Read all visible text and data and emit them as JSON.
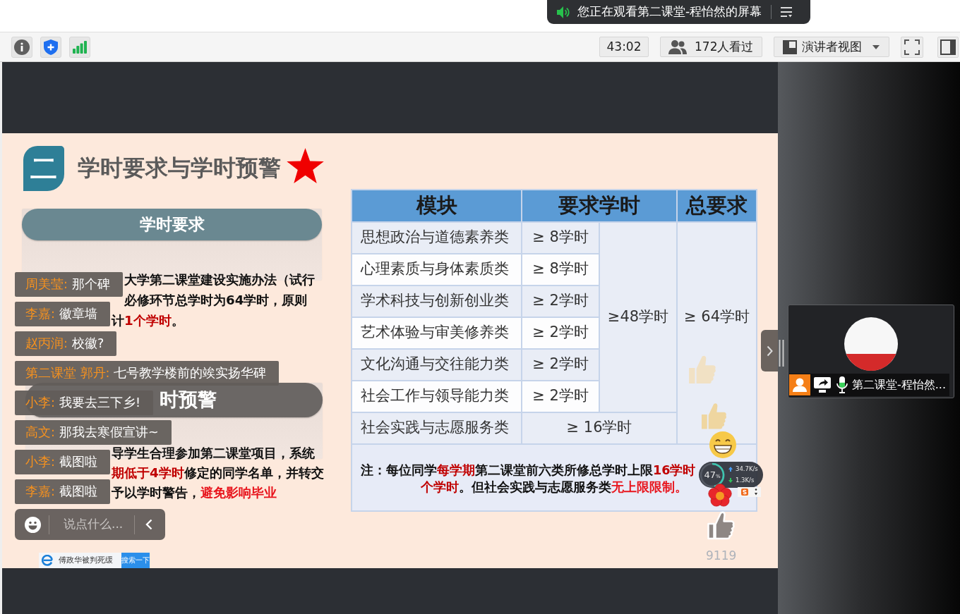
{
  "share_banner": {
    "text": "您正在观看第二课堂-程怡然的屏幕"
  },
  "toolbar": {
    "timer": "43:02",
    "viewers": "172人看过",
    "view_mode": "演讲者视图"
  },
  "slide": {
    "section_number": "二",
    "title": "学时要求与学时预警",
    "sections": [
      {
        "heading": "学时要求",
        "lines": [
          [
            {
              "text": "大学第二课堂建设实施办法（试行",
              "color": "#111111"
            }
          ],
          [
            {
              "text": "必修环节总学时为64学时，原则",
              "color": "#111111"
            }
          ],
          [
            {
              "text": "计",
              "color": "#111111"
            },
            {
              "text": "1个学时",
              "color": "#c00000"
            },
            {
              "text": "。",
              "color": "#111111"
            }
          ]
        ]
      },
      {
        "heading": "时预警",
        "lines": [
          [
            {
              "text": "导学生合理参加第二课堂项目，系统",
              "color": "#111111"
            }
          ],
          [
            {
              "text": "期低于4学时",
              "color": "#c00000"
            },
            {
              "text": "修定的同学名单，并转交",
              "color": "#111111"
            }
          ],
          [
            {
              "text": "予以学时警告，",
              "color": "#111111"
            },
            {
              "text": "避免影响毕业",
              "color": "#e8141c"
            }
          ]
        ]
      }
    ],
    "table": {
      "columns": [
        "模块",
        "要求学时",
        "总要求"
      ],
      "rows": [
        {
          "module": "思想政治与道德素养类",
          "hours": "≥ 8学时",
          "kind": "core"
        },
        {
          "module": "心理素质与身体素质类",
          "hours": "≥ 8学时",
          "kind": "core"
        },
        {
          "module": "学术科技与创新创业类",
          "hours": "≥ 2学时",
          "kind": "core"
        },
        {
          "module": "艺术体验与审美修养类",
          "hours": "≥ 2学时",
          "kind": "core"
        },
        {
          "module": "文化沟通与交往能力类",
          "hours": "≥ 2学时",
          "kind": "core"
        },
        {
          "module": "社会工作与领导能力类",
          "hours": "≥ 2学时",
          "kind": "core"
        },
        {
          "module": "社会实践与志愿服务类",
          "hours": "≥ 16学时",
          "kind": "extra"
        }
      ],
      "subtotal": "≥48学时",
      "total": "≥ 64学时",
      "note": [
        [
          {
            "text": "注：每位同学",
            "color": "#111111"
          },
          {
            "text": "每学期",
            "color": "#c00000"
          },
          {
            "text": "第二课堂前六类所修总学时上限",
            "color": "#111111"
          },
          {
            "text": "16学时",
            "color": "#c00000"
          }
        ],
        [
          {
            "text": "个学时",
            "color": "#c00000"
          },
          {
            "text": "。但社会实践与志愿服务类",
            "color": "#111111"
          },
          {
            "text": "无上限限制。",
            "color": "#e8141c"
          }
        ]
      ]
    }
  },
  "chat": {
    "messages": [
      {
        "name": "周美莹:",
        "text": "那个碑"
      },
      {
        "name": "李嘉:",
        "text": "徽章墙"
      },
      {
        "name": "赵丙润:",
        "text": "校徽?"
      },
      {
        "name": "第二课堂 郭丹:",
        "text": "七号教学楼前的竢实扬华碑"
      },
      {
        "name": "小李:",
        "text": "我要去三下乡!"
      },
      {
        "name": "高文:",
        "text": "那我去寒假宣讲~"
      },
      {
        "name": "小李:",
        "text": "截图啦"
      },
      {
        "name": "李嘉:",
        "text": "截图啦"
      }
    ],
    "input": {
      "placeholder": "说点什么..."
    }
  },
  "search_strip": {
    "query": "傅政华被判死缓",
    "button": "搜索一下"
  },
  "reactions": {
    "likes": "9119"
  },
  "net_widget": {
    "reading": "47$_{%}$",
    "level": 0.47,
    "upload": "34.7K/s",
    "download": "1.3K/s"
  },
  "video_tile": {
    "name": "第二课堂-程怡然...",
    "mic": {
      "level": 0.45
    }
  }
}
